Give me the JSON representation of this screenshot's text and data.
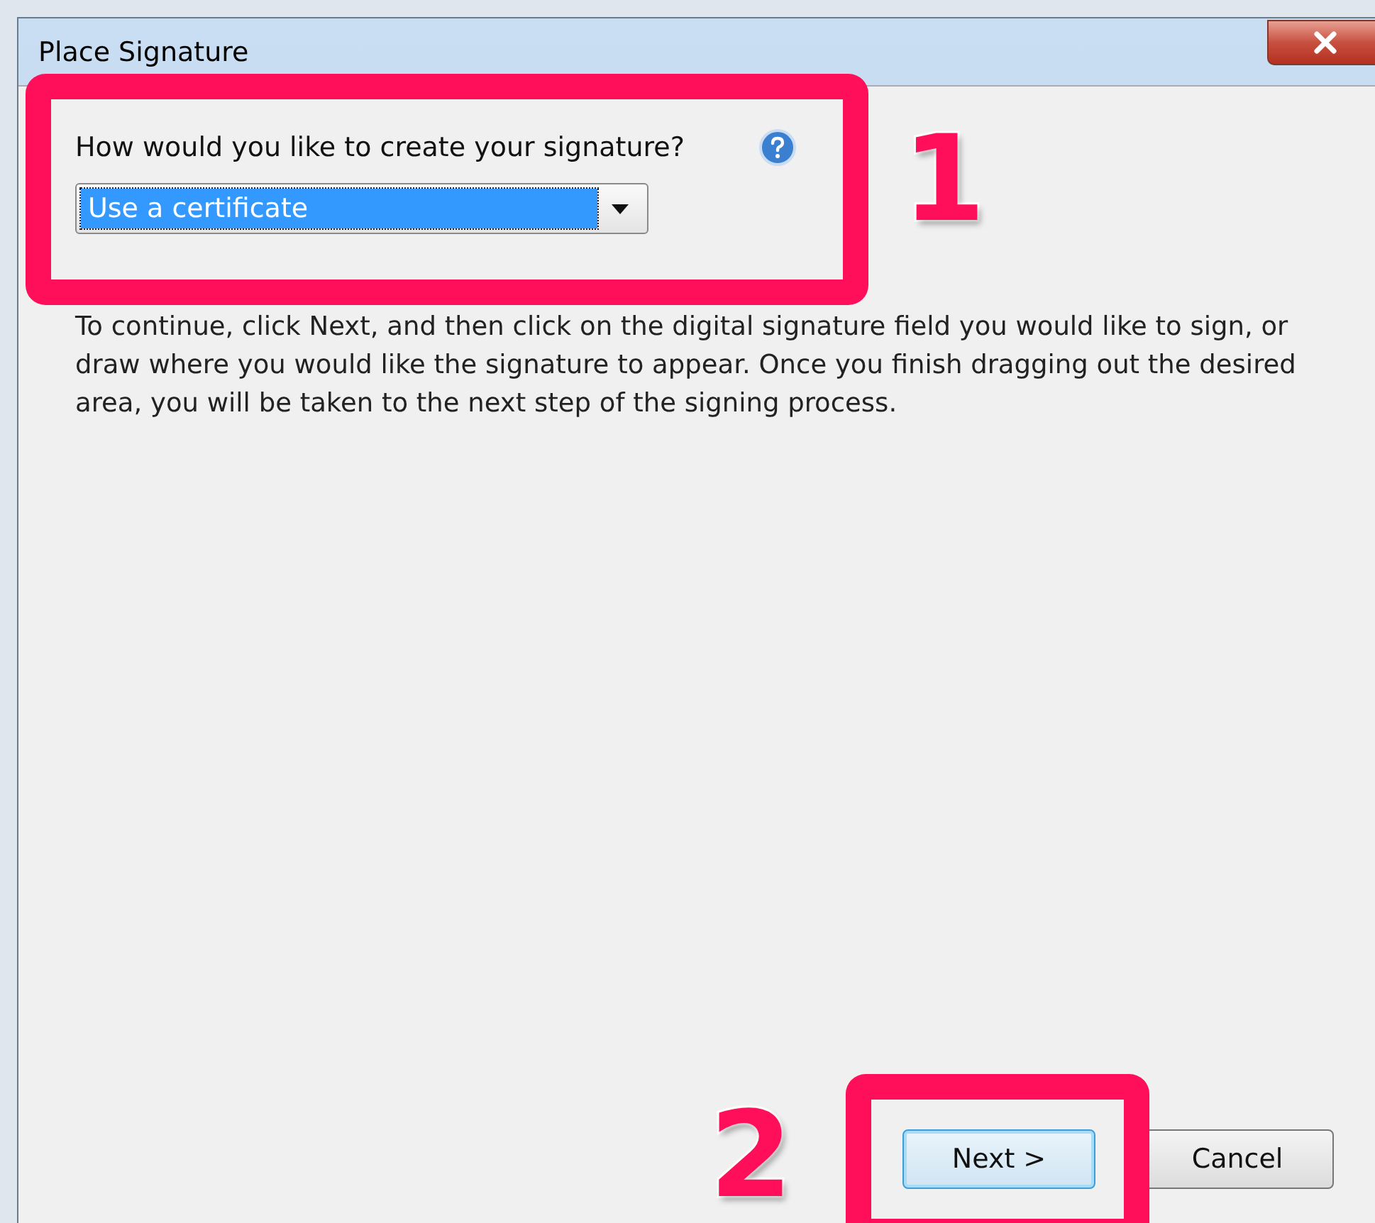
{
  "window": {
    "title": "Place Signature"
  },
  "question": {
    "label": "How would you like to create your signature?",
    "value": "Use a certificate"
  },
  "instructions": "To continue, click Next, and then click on the digital signature field you would like to sign, or draw where you would like the signature to appear. Once you finish dragging out the desired area, you will be taken to the next step of the signing process.",
  "buttons": [
    {
      "label": "Next >",
      "kind": "default"
    },
    {
      "label": "Cancel",
      "kind": "normal"
    }
  ],
  "annotations": [
    {
      "number": "1"
    },
    {
      "number": "2"
    }
  ]
}
